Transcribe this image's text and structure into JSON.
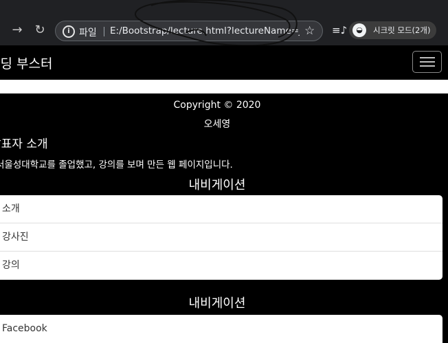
{
  "browser": {
    "back_icon": "back-arrow-icon",
    "forward_glyph": "→",
    "reload_glyph": "↻",
    "file_label": "파일",
    "url": "E:/Bootstrap/lecture.html?lectureName=JavaScript",
    "incognito_label": "시크릿 모드(2개)"
  },
  "navbar": {
    "brand": "코딩 부스터"
  },
  "footer": {
    "copyright": "Copyright © 2020",
    "author": "오세영"
  },
  "intro": {
    "heading": "발표자 소개",
    "text": "서울성대학교를 졸업했고, 강의를 보며 만든 웹 페이지입니다."
  },
  "nav_section_1": {
    "heading": "내비게이션",
    "items": [
      "소개",
      "강사진",
      "강의"
    ]
  },
  "nav_section_2": {
    "heading": "내비게이션",
    "items": [
      "Facebook"
    ]
  }
}
